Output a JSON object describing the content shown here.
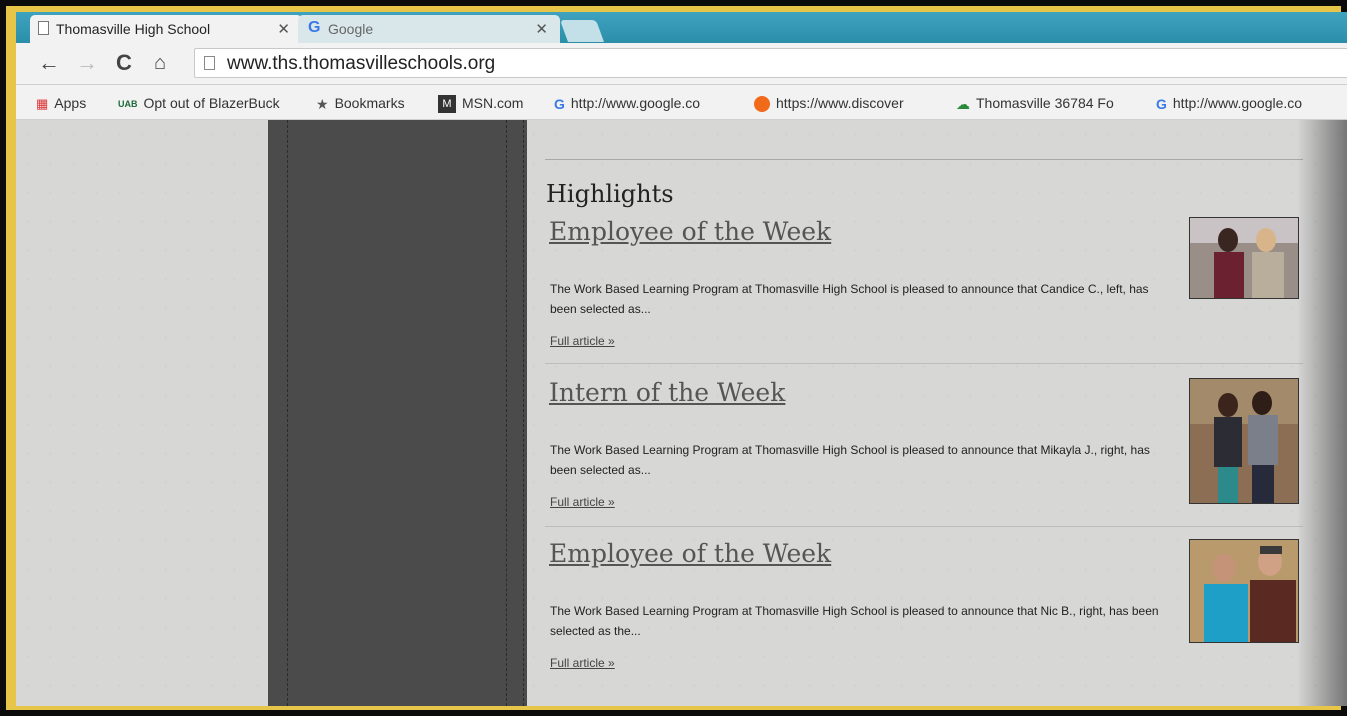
{
  "tabs": [
    {
      "label": "Thomasville High School",
      "active": true
    },
    {
      "label": "Google",
      "active": false
    }
  ],
  "toolbar": {
    "url": "www.ths.thomasvilleschools.org"
  },
  "bookmarks": [
    {
      "label": "Apps",
      "icon": "apps-grid-icon"
    },
    {
      "label": "Opt out of BlazerBuck",
      "icon": "uab-icon"
    },
    {
      "label": "Bookmarks",
      "icon": "star-icon"
    },
    {
      "label": "MSN.com",
      "icon": "msn-icon"
    },
    {
      "label": "http://www.google.co",
      "icon": "google-icon"
    },
    {
      "label": "https://www.discover",
      "icon": "orange-circle-icon"
    },
    {
      "label": "Thomasville 36784 Fo",
      "icon": "weather-icon"
    },
    {
      "label": "http://www.google.co",
      "icon": "google-icon"
    }
  ],
  "main": {
    "section_title": "Highlights",
    "articles": [
      {
        "title": "Employee of the Week",
        "summary": "The Work Based Learning Program at Thomasville High School is pleased to announce that Candice C., left, has been selected as...",
        "more": "Full article »"
      },
      {
        "title": "Intern of the Week",
        "summary": "The Work Based Learning Program at Thomasville High School is pleased to announce that Mikayla J., right, has been selected as...",
        "more": "Full article »"
      },
      {
        "title": "Employee of the Week",
        "summary": "The Work Based Learning Program at Thomasville High School is pleased to announce that Nic B., right, has been selected as the...",
        "more": "Full article »"
      }
    ]
  },
  "colors": {
    "frame": "#e7c548",
    "tabstrip": "#2b8ea9",
    "sidebar": "#4b4b4b",
    "page_bg": "#d7d7d6"
  }
}
